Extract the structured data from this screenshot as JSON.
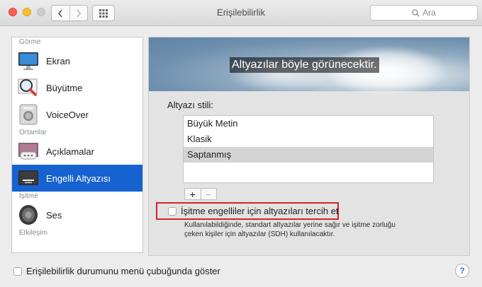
{
  "window": {
    "title": "Erişilebilirlik",
    "search_placeholder": "Ara"
  },
  "toolbar": {
    "back_icon": "chevron-left-icon",
    "forward_icon": "chevron-right-icon",
    "show_all_icon": "grid-icon"
  },
  "sidebar": {
    "sections": [
      {
        "label": "Görme"
      },
      {
        "label": "Ortamlar"
      },
      {
        "label": "İşitme"
      },
      {
        "label": "Etkileşim"
      }
    ],
    "items": [
      {
        "label": "Ekran",
        "icon": "display-icon"
      },
      {
        "label": "Büyütme",
        "icon": "magnifier-icon"
      },
      {
        "label": "VoiceOver",
        "icon": "voiceover-icon"
      },
      {
        "label": "Açıklamalar",
        "icon": "descriptions-icon"
      },
      {
        "label": "Engelli Altyazısı",
        "icon": "captions-icon",
        "selected": true
      },
      {
        "label": "Ses",
        "icon": "speaker-icon"
      }
    ]
  },
  "captions": {
    "preview_text": "Altyazılar böyle görünecektir.",
    "style_label": "Altyazı stili:",
    "styles": [
      "Büyük Metin",
      "Klasik",
      "Saptanmış"
    ],
    "selected_style": "Saptanmış",
    "add_label": "+",
    "remove_label": "−",
    "sdh_checkbox_label": "İşitme engelliler için altyazıları tercih et",
    "sdh_checked": false,
    "sdh_description_line1": "Kullanılabildiğinde, standart altyazılar yerine sağır ve işitme zorluğu",
    "sdh_description_line2": "çeken kişiler için altyazılar (SDH) kullanılacaktır.",
    "highlight_color": "#d0242b"
  },
  "footer": {
    "menu_bar_checkbox_label": "Erişilebilirlik durumunu menü çubuğunda göster",
    "menu_bar_checked": false,
    "help_label": "?"
  },
  "colors": {
    "selection": "#1762d1",
    "close": "#fd5f57",
    "minimize": "#febc2e",
    "zoom_inactive": "#cdcdcd"
  }
}
